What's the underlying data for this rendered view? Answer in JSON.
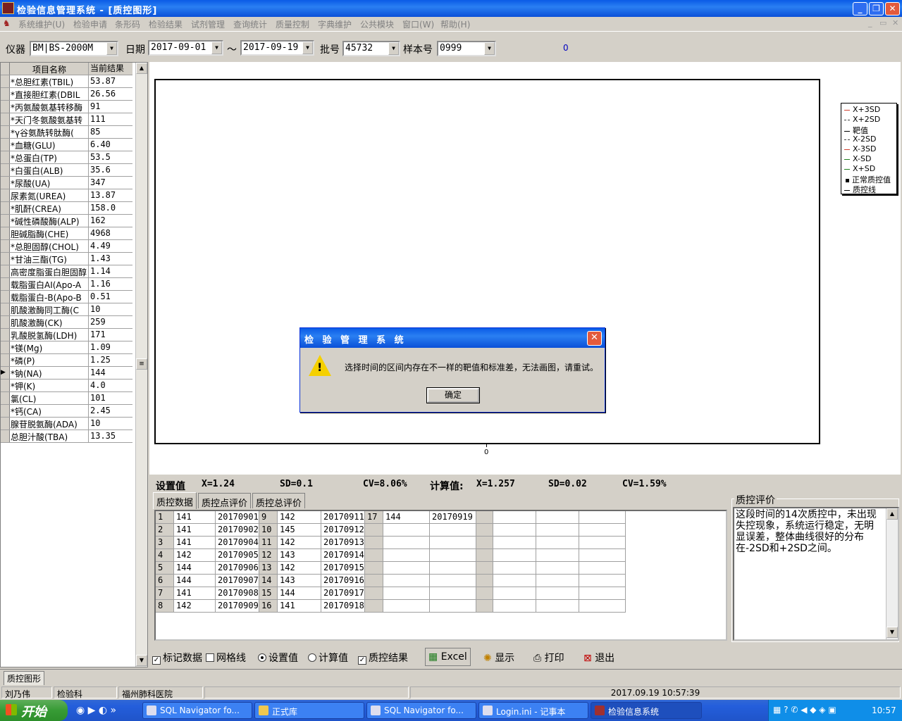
{
  "window": {
    "title": "检验信息管理系统 - [质控图形]"
  },
  "menu": [
    "系统维护(U)",
    "检验申请",
    "条形码",
    "检验结果",
    "试剂管理",
    "查询统计",
    "质量控制",
    "字典维护",
    "公共模块",
    "窗口(W)",
    "帮助(H)"
  ],
  "toolbar": {
    "instrument_label": "仪器",
    "instrument_value": "BM|BS-2000M",
    "date_label": "日期",
    "date_from": "2017-09-01",
    "tilde": "〜",
    "date_to": "2017-09-19",
    "batch_label": "批号",
    "batch_value": "45732",
    "sample_label": "样本号",
    "sample_value": "0999",
    "counter": "0"
  },
  "items_grid": {
    "headers": [
      "项目名称",
      "当前结果"
    ],
    "rows": [
      [
        "*总胆红素(TBIL)",
        "53.87"
      ],
      [
        "*直接胆红素(DBIL",
        "26.56"
      ],
      [
        "*丙氨酸氨基转移酶",
        "91"
      ],
      [
        "*天门冬氨酸氨基转",
        "111"
      ],
      [
        "*γ谷氨酰转肽酶(",
        "85"
      ],
      [
        "*血糖(GLU)",
        "6.40"
      ],
      [
        "*总蛋白(TP)",
        "53.5"
      ],
      [
        "*白蛋白(ALB)",
        "35.6"
      ],
      [
        "*尿酸(UA)",
        "347"
      ],
      [
        "尿素氮(UREA)",
        "13.87"
      ],
      [
        "*肌酐(CREA)",
        "158.0"
      ],
      [
        "*碱性磷酸酶(ALP)",
        "162"
      ],
      [
        "胆碱脂酶(CHE)",
        "4968"
      ],
      [
        "*总胆固醇(CHOL)",
        "4.49"
      ],
      [
        "*甘油三酯(TG)",
        "1.43"
      ],
      [
        "高密度脂蛋白胆固醇",
        "1.14"
      ],
      [
        "载脂蛋白AI(Apo-A",
        "1.16"
      ],
      [
        "载脂蛋白-B(Apo-B",
        "0.51"
      ],
      [
        "肌酸激酶同工酶(C",
        "10"
      ],
      [
        "肌酸激酶(CK)",
        "259"
      ],
      [
        "乳酸脱氢酶(LDH)",
        "171"
      ],
      [
        "*镁(Mg)",
        "1.09"
      ],
      [
        "*磷(P)",
        "1.25"
      ],
      [
        "*钠(NA)",
        "144"
      ],
      [
        "*钾(K)",
        "4.0"
      ],
      [
        "氯(CL)",
        "101"
      ],
      [
        "*钙(CA)",
        "2.45"
      ],
      [
        "腺苷脱氨酶(ADA)",
        "10"
      ],
      [
        "总胆汁酸(TBA)",
        "13.35"
      ]
    ],
    "current_row": 23
  },
  "chart": {
    "top_tick": "0",
    "bottom_tick": "0"
  },
  "legend": [
    {
      "label": "X+3SD",
      "color": "#d04030",
      "style": "solid"
    },
    {
      "label": "X+2SD",
      "color": "#404040",
      "style": "dashed"
    },
    {
      "label": "靶值",
      "color": "#000000",
      "style": "solid"
    },
    {
      "label": "X-2SD",
      "color": "#404040",
      "style": "dashed"
    },
    {
      "label": "X-3SD",
      "color": "#d04030",
      "style": "solid"
    },
    {
      "label": "X-SD",
      "color": "#208020",
      "style": "solid"
    },
    {
      "label": "X+SD",
      "color": "#208020",
      "style": "solid"
    },
    {
      "label": "正常质控值",
      "color": "#000000",
      "style": "square"
    },
    {
      "label": "质控线",
      "color": "#000000",
      "style": "solid"
    }
  ],
  "stats": {
    "set_label": "设置值",
    "set_x": "X=1.24",
    "set_sd": "SD=0.1",
    "set_cv": "CV=8.06%",
    "calc_label": "计算值:",
    "calc_x": "X=1.257",
    "calc_sd": "SD=0.02",
    "calc_cv": "CV=1.59%"
  },
  "tabs": [
    "质控数据",
    "质控点评价",
    "质控总评价"
  ],
  "qc_data": {
    "rows": [
      [
        "1",
        "141",
        "20170901",
        "9",
        "142",
        "20170911",
        "17",
        "144",
        "20170919"
      ],
      [
        "2",
        "141",
        "20170902",
        "10",
        "145",
        "20170912",
        "",
        "",
        ""
      ],
      [
        "3",
        "141",
        "20170904",
        "11",
        "142",
        "20170913",
        "",
        "",
        ""
      ],
      [
        "4",
        "142",
        "20170905",
        "12",
        "143",
        "20170914",
        "",
        "",
        ""
      ],
      [
        "5",
        "144",
        "20170906",
        "13",
        "142",
        "20170915",
        "",
        "",
        ""
      ],
      [
        "6",
        "144",
        "20170907",
        "14",
        "143",
        "20170916",
        "",
        "",
        ""
      ],
      [
        "7",
        "141",
        "20170908",
        "15",
        "144",
        "20170917",
        "",
        "",
        ""
      ],
      [
        "8",
        "142",
        "20170909",
        "16",
        "141",
        "20170918",
        "",
        "",
        ""
      ]
    ]
  },
  "evaluation": {
    "title": "质控评价",
    "text": "这段时间的14次质控中，未出现失控现象，系统运行稳定，无明显误差，整体曲线很好的分布在-2SD和+2SD之间。"
  },
  "bottom": {
    "mark_data": "标记数据",
    "grid_lines": "网格线",
    "set_value": "设置值",
    "calc_value": "计算值",
    "qc_result": "质控结果",
    "excel": "Excel",
    "show": "显示",
    "print": "打印",
    "exit": "退出"
  },
  "mdi_tab": "质控图形",
  "status": {
    "user": "刘乃伟",
    "dept": "检验科",
    "hospital": "福州肺科医院",
    "datetime": "2017.09.19 10:57:39"
  },
  "taskbar": {
    "start": "开始",
    "items": [
      "SQL Navigator fo...",
      "正式库",
      "SQL Navigator fo...",
      "Login.ini - 记事本",
      "检验信息系统"
    ],
    "clock": "10:57"
  },
  "dialog": {
    "title": "检 验 管 理 系 统",
    "message": "选择时间的区间内存在不一样的靶值和标准差，无法画图，请重试。",
    "ok": "确定",
    "close": "✕"
  }
}
